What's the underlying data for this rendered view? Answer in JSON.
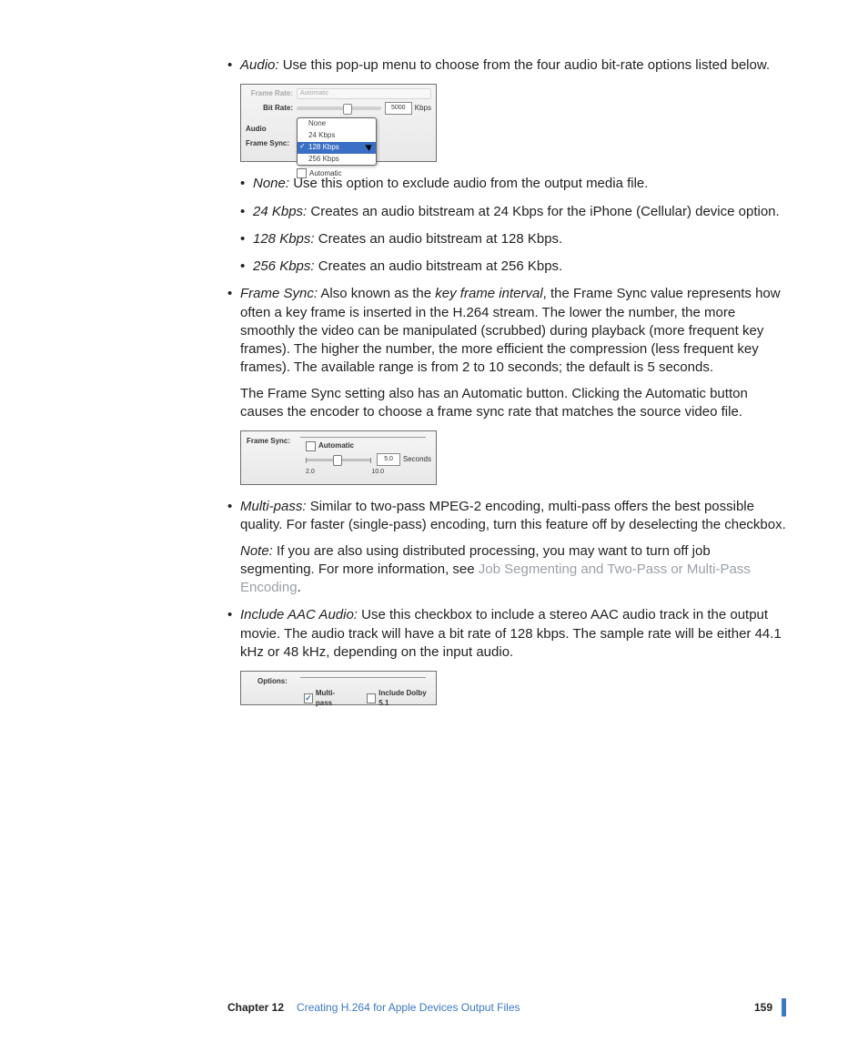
{
  "bullets": {
    "audio": {
      "term": "Audio:",
      "text": "Use this pop-up menu to choose from the four audio bit-rate options listed below.",
      "sub": [
        {
          "term": "None:",
          "text": "Use this option to exclude audio from the output media file."
        },
        {
          "term": "24 Kbps:",
          "text": "Creates an audio bitstream at 24 Kbps for the iPhone (Cellular) device option."
        },
        {
          "term": "128 Kbps:",
          "text": "Creates an audio bitstream at 128 Kbps."
        },
        {
          "term": "256 Kbps:",
          "text": "Creates an audio bitstream at 256 Kbps."
        }
      ]
    },
    "framesync": {
      "term": "Frame Sync:",
      "pre": "Also known as the ",
      "em": "key frame interval",
      "post": ", the Frame Sync value represents how often a key frame is inserted in the H.264 stream. The lower the number, the more smoothly the video can be manipulated (scrubbed) during playback (more frequent key frames). The higher the number, the more efficient the compression (less frequent key frames). The available range is from 2 to 10 seconds; the default is 5 seconds.",
      "para2": "The Frame Sync setting also has an Automatic button. Clicking the Automatic button causes the encoder to choose a frame sync rate that matches the source video file."
    },
    "multipass": {
      "term": "Multi-pass:",
      "text": "Similar to two-pass MPEG-2 encoding, multi-pass offers the best possible quality. For faster (single-pass) encoding, turn this feature off by deselecting the checkbox.",
      "note_term": "Note:",
      "note_pre": "If you are also using distributed processing, you may want to turn off job segmenting. For more information, see ",
      "note_link": "Job Segmenting and Two-Pass or Multi-Pass Encoding",
      "note_post": "."
    },
    "aac": {
      "term": "Include AAC Audio:",
      "text": "Use this checkbox to include a stereo AAC audio track in the output movie. The audio track will have a bit rate of 128 kbps. The sample rate will be either 44.1 kHz or 48 kHz, depending on the input audio."
    }
  },
  "shot1": {
    "frame_rate": "Frame Rate:",
    "frame_rate_val": "Automatic",
    "bitrate": "Bit Rate:",
    "bitrate_val": "5000",
    "bitrate_unit": "Kbps",
    "audio": "Audio",
    "framesync": "Frame Sync:",
    "automatic": "Automatic",
    "options": [
      "None",
      "24 Kbps",
      "128 Kbps",
      "256 Kbps"
    ],
    "selected": "128 Kbps"
  },
  "shot2": {
    "label": "Frame Sync:",
    "automatic": "Automatic",
    "value": "5.0",
    "unit": "Seconds",
    "min": "2.0",
    "max": "10.0"
  },
  "shot3": {
    "label": "Options:",
    "multipass": "Multi-pass",
    "dolby": "Include Dolby 5.1"
  },
  "footer": {
    "chapter": "Chapter 12",
    "title": "Creating H.264 for Apple Devices Output Files",
    "page": "159"
  }
}
